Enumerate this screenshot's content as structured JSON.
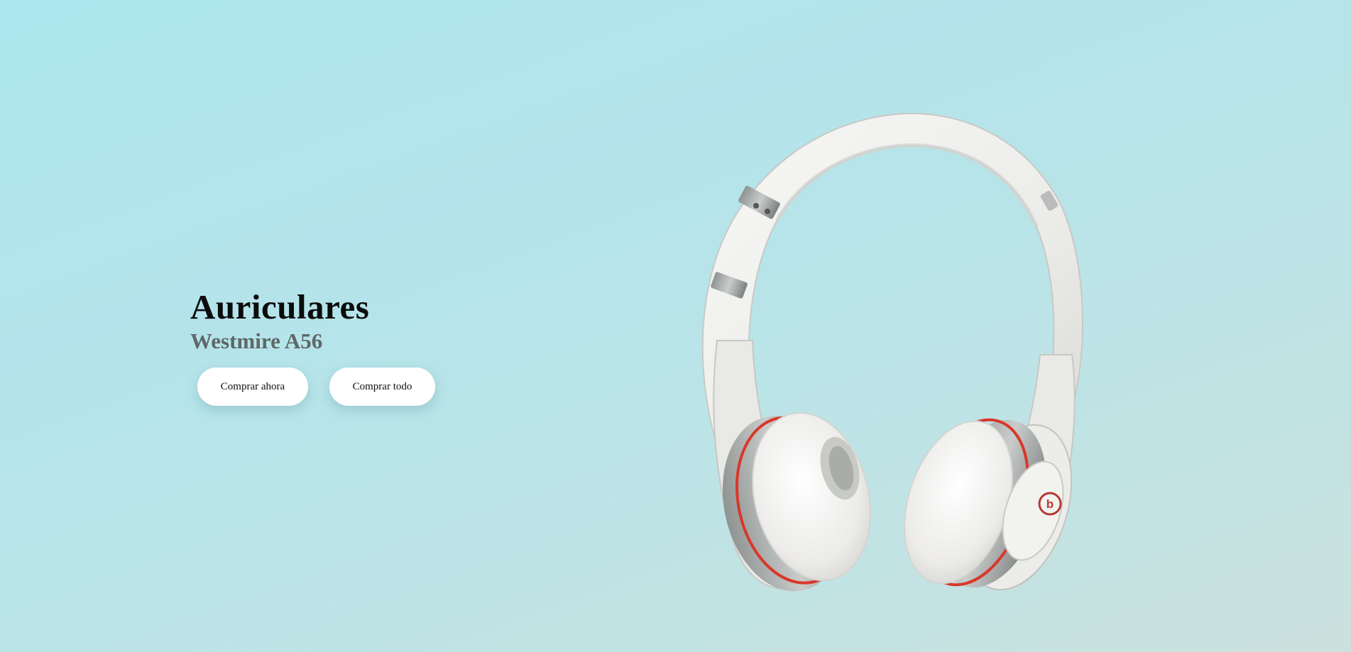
{
  "hero": {
    "title": "Auriculares",
    "subtitle": "Westmire A56"
  },
  "buttons": {
    "buy_now": "Comprar ahora",
    "buy_all": "Comprar todo"
  },
  "product_image": {
    "icon": "headphones-image",
    "brand_mark": "b"
  },
  "colors": {
    "background_start": "#ade6ef",
    "background_end": "#cbe1de",
    "accent_red": "#d9372a",
    "button_bg": "#ffffff"
  }
}
